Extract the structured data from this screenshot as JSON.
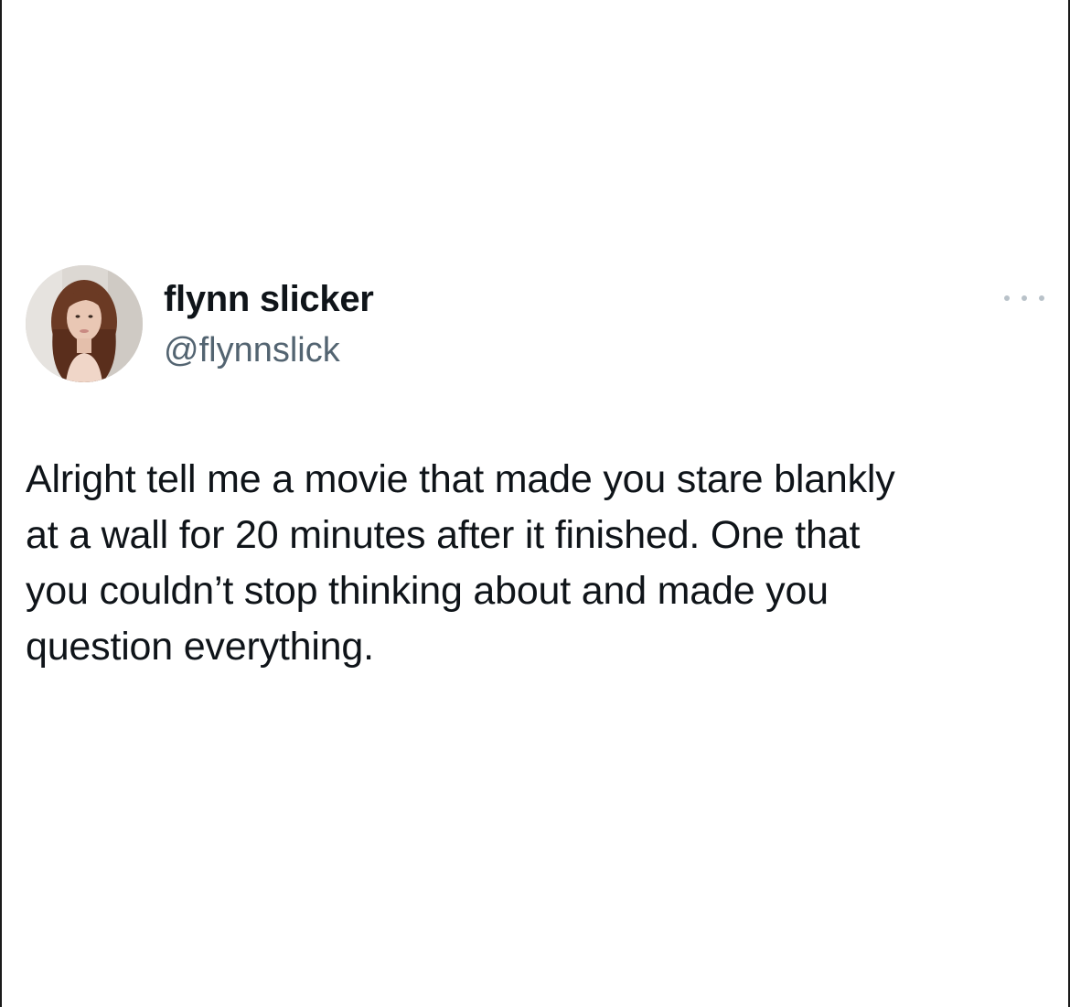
{
  "tweet": {
    "author": {
      "display_name": "flynn slicker",
      "handle": "@flynnslick",
      "avatar_icon": "profile-photo"
    },
    "more_icon": "ellipsis-icon",
    "text": "Alright tell me a movie that made you stare blankly\nat a wall for 20 minutes after it finished. One that\nyou couldn’t stop thinking about and made you\nquestion everything."
  },
  "colors": {
    "text_primary": "#0f1419",
    "text_secondary": "#536471",
    "background": "#ffffff"
  }
}
